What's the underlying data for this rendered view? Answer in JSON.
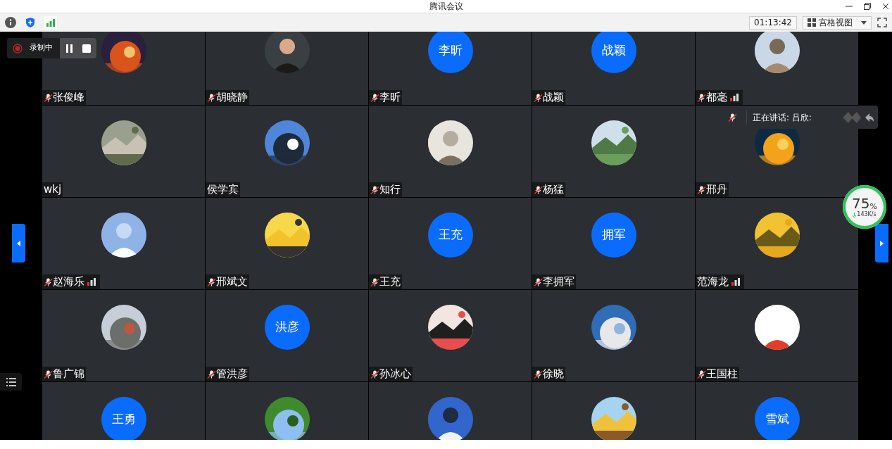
{
  "window": {
    "title": "腾讯会议"
  },
  "toolbar": {
    "time": "01:13:42",
    "view": "宫格视图"
  },
  "recording": {
    "label": "录制中"
  },
  "speaking": {
    "text": "正在讲话: 吕欣:"
  },
  "network": {
    "percent": "75",
    "unit": "%",
    "speed": "143K/s"
  },
  "tiles": [
    {
      "name": "张俊峰",
      "muted": true,
      "signal": false,
      "avatar": {
        "kind": "picture"
      }
    },
    {
      "name": "胡晓静",
      "muted": true,
      "signal": false,
      "avatar": {
        "kind": "picture"
      }
    },
    {
      "name": "李昕",
      "muted": true,
      "signal": false,
      "avatar": {
        "kind": "initials",
        "text": "李昕"
      }
    },
    {
      "name": "战颖",
      "muted": true,
      "signal": false,
      "avatar": {
        "kind": "initials",
        "text": "战颖"
      }
    },
    {
      "name": "都毫",
      "muted": true,
      "signal": true,
      "avatar": {
        "kind": "picture"
      }
    },
    {
      "name": "wkj",
      "muted": false,
      "signal": false,
      "avatar": {
        "kind": "picture"
      }
    },
    {
      "name": "侯学宾",
      "muted": false,
      "signal": false,
      "avatar": {
        "kind": "picture"
      }
    },
    {
      "name": "知行",
      "muted": true,
      "signal": false,
      "avatar": {
        "kind": "picture"
      }
    },
    {
      "name": "杨猛",
      "muted": true,
      "signal": false,
      "avatar": {
        "kind": "picture"
      }
    },
    {
      "name": "邢丹",
      "muted": true,
      "signal": false,
      "avatar": {
        "kind": "picture"
      }
    },
    {
      "name": "赵海乐",
      "muted": true,
      "signal": true,
      "avatar": {
        "kind": "picture"
      }
    },
    {
      "name": "邢斌文",
      "muted": true,
      "signal": false,
      "avatar": {
        "kind": "picture"
      }
    },
    {
      "name": "王充",
      "muted": true,
      "signal": false,
      "avatar": {
        "kind": "initials",
        "text": "王充"
      }
    },
    {
      "name": "李拥军",
      "muted": true,
      "signal": false,
      "avatar": {
        "kind": "initials",
        "text": "拥军"
      }
    },
    {
      "name": "范海龙",
      "muted": false,
      "signal": true,
      "avatar": {
        "kind": "picture"
      }
    },
    {
      "name": "鲁广锦",
      "muted": true,
      "signal": false,
      "avatar": {
        "kind": "picture"
      }
    },
    {
      "name": "管洪彦",
      "muted": true,
      "signal": false,
      "avatar": {
        "kind": "initials",
        "text": "洪彦"
      }
    },
    {
      "name": "孙冰心",
      "muted": true,
      "signal": false,
      "avatar": {
        "kind": "picture"
      }
    },
    {
      "name": "徐晓",
      "muted": true,
      "signal": false,
      "avatar": {
        "kind": "picture"
      }
    },
    {
      "name": "王国柱",
      "muted": true,
      "signal": false,
      "avatar": {
        "kind": "picture"
      }
    },
    {
      "avatar": {
        "kind": "initials",
        "text": "王勇"
      }
    },
    {
      "avatar": {
        "kind": "picture"
      }
    },
    {
      "avatar": {
        "kind": "picture"
      }
    },
    {
      "avatar": {
        "kind": "picture"
      }
    },
    {
      "avatar": {
        "kind": "initials",
        "text": "雪斌"
      }
    }
  ]
}
